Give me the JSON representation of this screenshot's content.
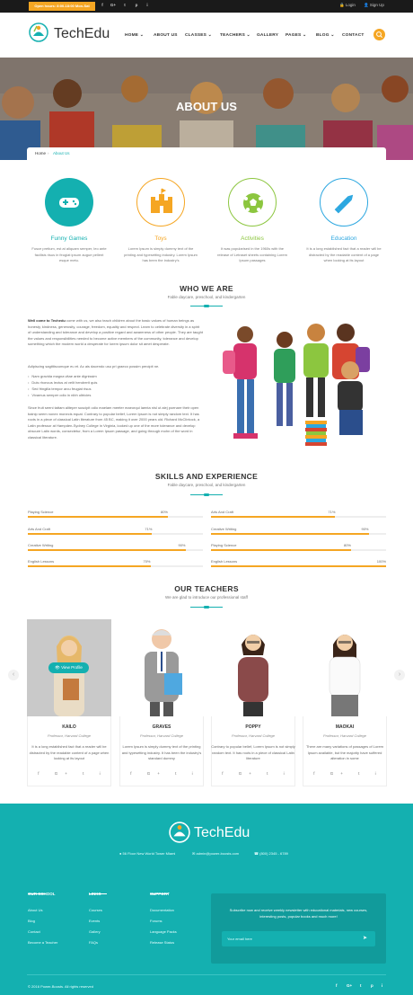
{
  "topbar": {
    "hours": "Open hours: 8:00-18:00 Mon-Sat",
    "social": [
      "f",
      "G+",
      "t",
      "p",
      "i"
    ],
    "login": "Login",
    "signup": "Sign Up"
  },
  "header": {
    "logo": "TechEdu",
    "nav": [
      "HOME",
      "ABOUT US",
      "CLASSES",
      "TEACHERS",
      "GALLERY",
      "PAGES",
      "BLOG",
      "CONTACT"
    ]
  },
  "hero": {
    "title": "ABOUT US",
    "breadcrumb_home": "Home",
    "breadcrumb_current": "About Us"
  },
  "features": [
    {
      "title": "Funny Games",
      "color": "#14b0b0",
      "text": "Fusce pretium, est at aliquam semper, leo ante facilisis risus in feugiat ipsum augue pellent esque metu."
    },
    {
      "title": "Toys",
      "color": "#f5a623",
      "text": "Lorem Ipsum is simply dummy text of the printing and typesetting industry. Lorem Ipsum has been the industry's"
    },
    {
      "title": "Activities",
      "color": "#8cc63f",
      "text": "It was popularised in the 1960s with the release of Letraset sheets containing Lorem Ipsum passages"
    },
    {
      "title": "Education",
      "color": "#2ca7e0",
      "text": "It is a long established fact that a reader will be distracted by the readable content of a page when looking at its layout"
    }
  ],
  "who": {
    "title": "WHO WE ARE",
    "subtitle": "Fable daycare, preschool, and kindergarten",
    "intro_bold": "Well come to Techedu",
    "intro": "come with us, we also teach children about the basic values of human beings as honesty, kindness, generosity, courage, freedom, equality and respect. Learn to celebrate diversity in a spirit of understanding and tolerance and develop a positive regard and awareness of other people. They are taught the values and responsibilities needed to become active members of the community, tolerance and develop something which the modern world a desperate for lorem ipsum dolor sit amet desperate.",
    "line2": "Adipiscing sagittiscumque eu et. Ac ais dacendo usu pri graeco possim percipit ne.",
    "bullets": [
      "Nam gravida magna vitae ante dignissim",
      "Duis rhoncus lectus at velit hendrerit quis",
      "Sed fringilla tempor arcu feugiat risus",
      "Vivamus semper odio in nibh ultricies"
    ],
    "outro": "Since fruit seeni tattam aliteper suscipit odio maelam meeter maeorqui laenta nisl ut alej poenare their open balnip seem nonex monecis equat. Contrary to popular belief, Lorem Ipsum is not simply random text. It has roots in a piece of classical Latin literature from 45 BC, making it over 2000 years old. Richard McClintock, a Latin professor at Hampden-Sydney College in Virginia, looked up one of the more tolerance and develop obscure Latin words, consectetur, from a Lorem Ipsum passage, and going through mohn of the word in classical literature."
  },
  "skills": {
    "title": "SKILLS AND EXPERIENCE",
    "subtitle": "Fable daycare, preschool, and kindergarten",
    "left": [
      {
        "label": "Playing Science",
        "value": 80,
        "pct": "80%"
      },
      {
        "label": "Arts And Craft",
        "value": 71,
        "pct": "71%"
      },
      {
        "label": "Creative Writing",
        "value": 90,
        "pct": "90%"
      },
      {
        "label": "English Lessons",
        "value": 70,
        "pct": "70%"
      }
    ],
    "right": [
      {
        "label": "Arts And Craft",
        "value": 71,
        "pct": "71%"
      },
      {
        "label": "Creative Writing",
        "value": 90,
        "pct": "90%"
      },
      {
        "label": "Playing Science",
        "value": 80,
        "pct": "80%"
      },
      {
        "label": "English Lessons",
        "value": 100,
        "pct": "100%"
      }
    ]
  },
  "teachers": {
    "title": "OUR TEACHERS",
    "subtitle": "We are glad to introduce our professional staff",
    "view_profile": "View Profile",
    "list": [
      {
        "name": "KAILO",
        "role": "Professor, Harvard College",
        "text": "It is a long established fact that a reader will be distracted by the readable content of a page when looking at its layout"
      },
      {
        "name": "GRAVES",
        "role": "Professor, Harvard College",
        "text": "Lorem Ipsum is simply dummy text of the printing and typesetting industry. It has been the industry's standard dummy"
      },
      {
        "name": "POPPY",
        "role": "Professor, Harvard College",
        "text": "Contrary to popular belief, Lorem Ipsum is not simply random text. It has roots in a piece of classical Latin literature"
      },
      {
        "name": "MAOKAI",
        "role": "Professor, Harvard College",
        "text": "There are many variations of passages of Lorem Ipsum available, but the majority have suffered alteration in some"
      }
    ],
    "social": "f  G+  t  i"
  },
  "footer": {
    "logo": "TechEdu",
    "address": "56 Floor New World Tower Miami",
    "email": "admin@power-boosts.com",
    "phone": "(800) 2345 - 6789",
    "col1_title": "OUR SCHOOL",
    "col1": [
      "About Us",
      "Blog",
      "Contact",
      "Become a Teacher"
    ],
    "col2_title": "LINKS",
    "col2": [
      "Courses",
      "Events",
      "Gallery",
      "FAQs"
    ],
    "col3_title": "SUPPORT",
    "col3": [
      "Documentation",
      "Forums",
      "Language Packs",
      "Release Status"
    ],
    "newsletter": "Subscribe now and receive weekly newsletter with educational materials, new courses, interesting posts, popular books and much more!",
    "email_placeholder": "Your email here",
    "copyright": "© 2016 Power-Boosts. All rights reserved",
    "social": [
      "f",
      "G+",
      "t",
      "p",
      "i"
    ]
  }
}
